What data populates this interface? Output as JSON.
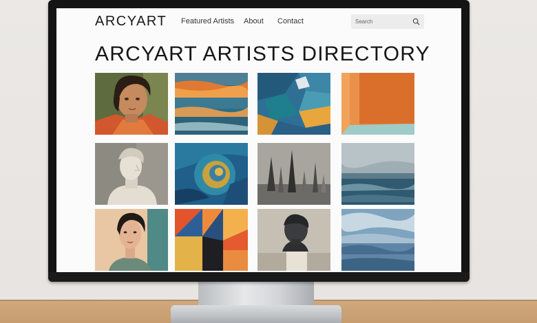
{
  "nav": {
    "logo": "ARCYART",
    "links": [
      "Featured Artists",
      "About",
      "Contact"
    ]
  },
  "search": {
    "placeholder": "Search",
    "icon": "search-icon"
  },
  "page": {
    "title": "ARCYART ARTISTS DIRECTORY"
  },
  "colors": {
    "screen_bg": "#fbfbfb",
    "text": "#161616",
    "search_bg": "#ececec",
    "bezel": "#141414"
  }
}
